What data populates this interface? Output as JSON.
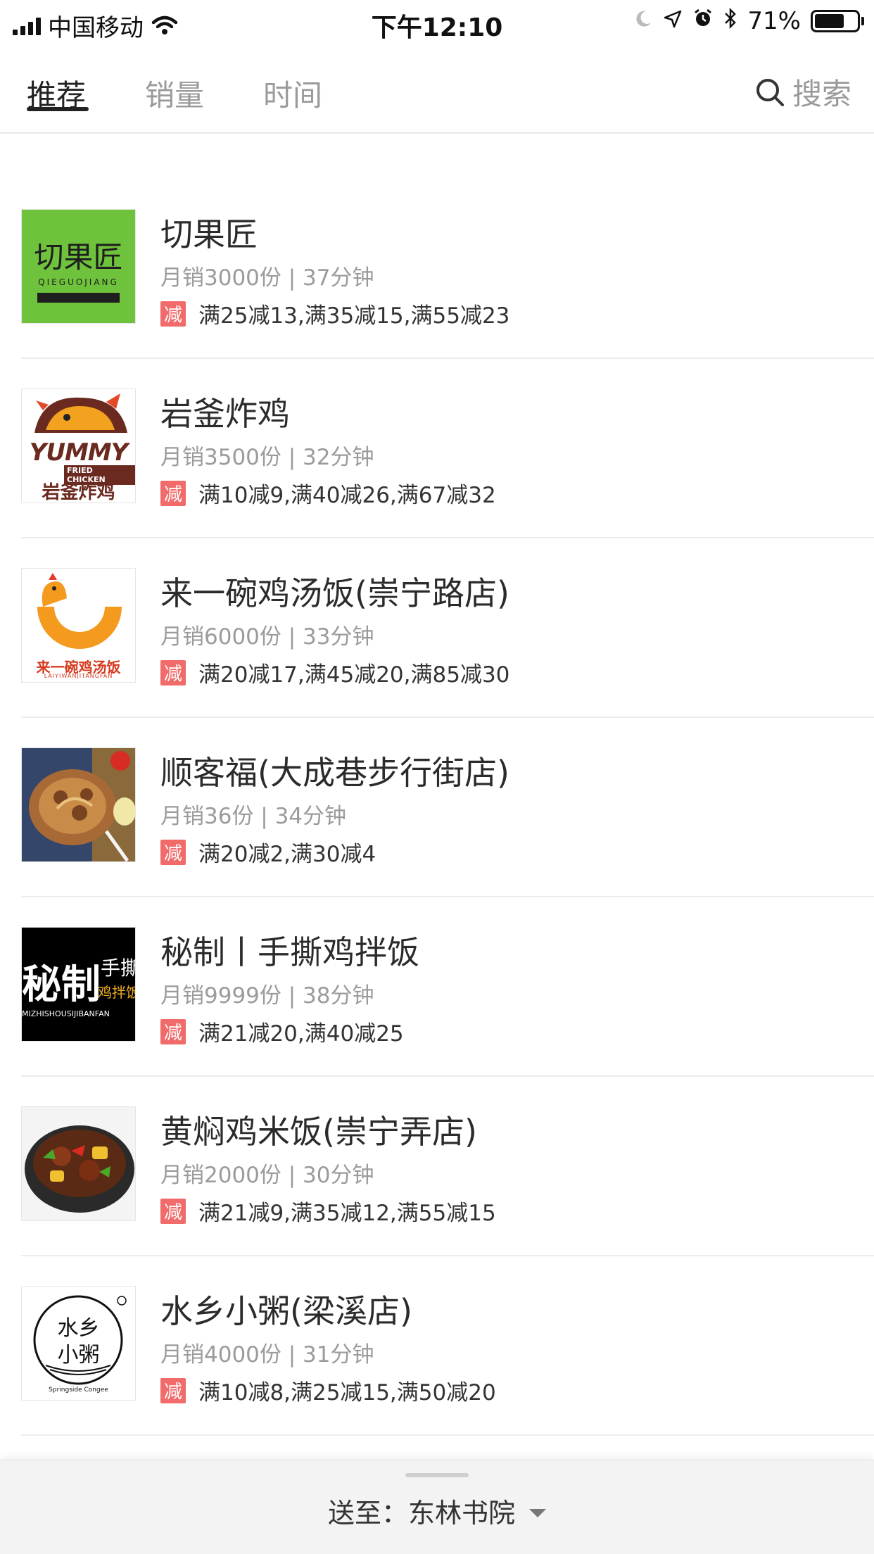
{
  "status_bar": {
    "carrier": "中国移动",
    "time": "下午12:10",
    "battery_percent": "71%",
    "battery_level": 0.71,
    "icons": [
      "signal-icon",
      "wifi-icon",
      "moon-icon",
      "location-icon",
      "alarm-icon",
      "bluetooth-icon",
      "battery-icon"
    ]
  },
  "tabs": [
    {
      "label": "推荐",
      "active": true
    },
    {
      "label": "销量",
      "active": false
    },
    {
      "label": "时间",
      "active": false
    }
  ],
  "search": {
    "label": "搜索"
  },
  "colors": {
    "promo_badge": "#f26b6b",
    "active_tab": "#222222",
    "inactive_tab": "#9a9a9a"
  },
  "restaurants": [
    {
      "name": "切果匠",
      "meta": "月销3000份 | 37分钟",
      "badge": "减",
      "promo": "满25减13,满35减15,满55减23",
      "logo_text": "切果匠",
      "logo_sub": "QIEGUOJIANG"
    },
    {
      "name": "岩釜炸鸡",
      "meta": "月销3500份 | 32分钟",
      "badge": "减",
      "promo": "满10减9,满40减26,满67减32",
      "logo_text": "YUMMY",
      "logo_sub": "FRIED CHICKEN",
      "logo_cn": "岩釜炸鸡"
    },
    {
      "name": "来一碗鸡汤饭(崇宁路店)",
      "meta": "月销6000份 | 33分钟",
      "badge": "减",
      "promo": "满20减17,满45减20,满85减30",
      "logo_text": "来一碗鸡汤饭",
      "logo_sub": "LAIYIWANJITANGFAN"
    },
    {
      "name": "顺客福(大成巷步行街店)",
      "meta": "月销36份 | 34分钟",
      "badge": "减",
      "promo": "满20减2,满30减4"
    },
    {
      "name": "秘制丨手撕鸡拌饭",
      "meta": "月销9999份 | 38分钟",
      "badge": "减",
      "promo": "满21减20,满40减25",
      "logo_text": "秘制",
      "logo_text2": "手撕",
      "logo_text3": "鸡拌饭",
      "logo_sub": "MIZHISHOUSIJIBANFAN"
    },
    {
      "name": "黄焖鸡米饭(崇宁弄店)",
      "meta": "月销2000份 | 30分钟",
      "badge": "减",
      "promo": "满21减9,满35减12,满55减15"
    },
    {
      "name": "水乡小粥(梁溪店)",
      "meta": "月销4000份 | 31分钟",
      "badge": "减",
      "promo": "满10减8,满25减15,满50减20",
      "logo_text": "水乡",
      "logo_text2": "小粥",
      "logo_sub": "Springside Congee"
    }
  ],
  "bottom_bar": {
    "deliver_to": "送至：东林书院"
  }
}
